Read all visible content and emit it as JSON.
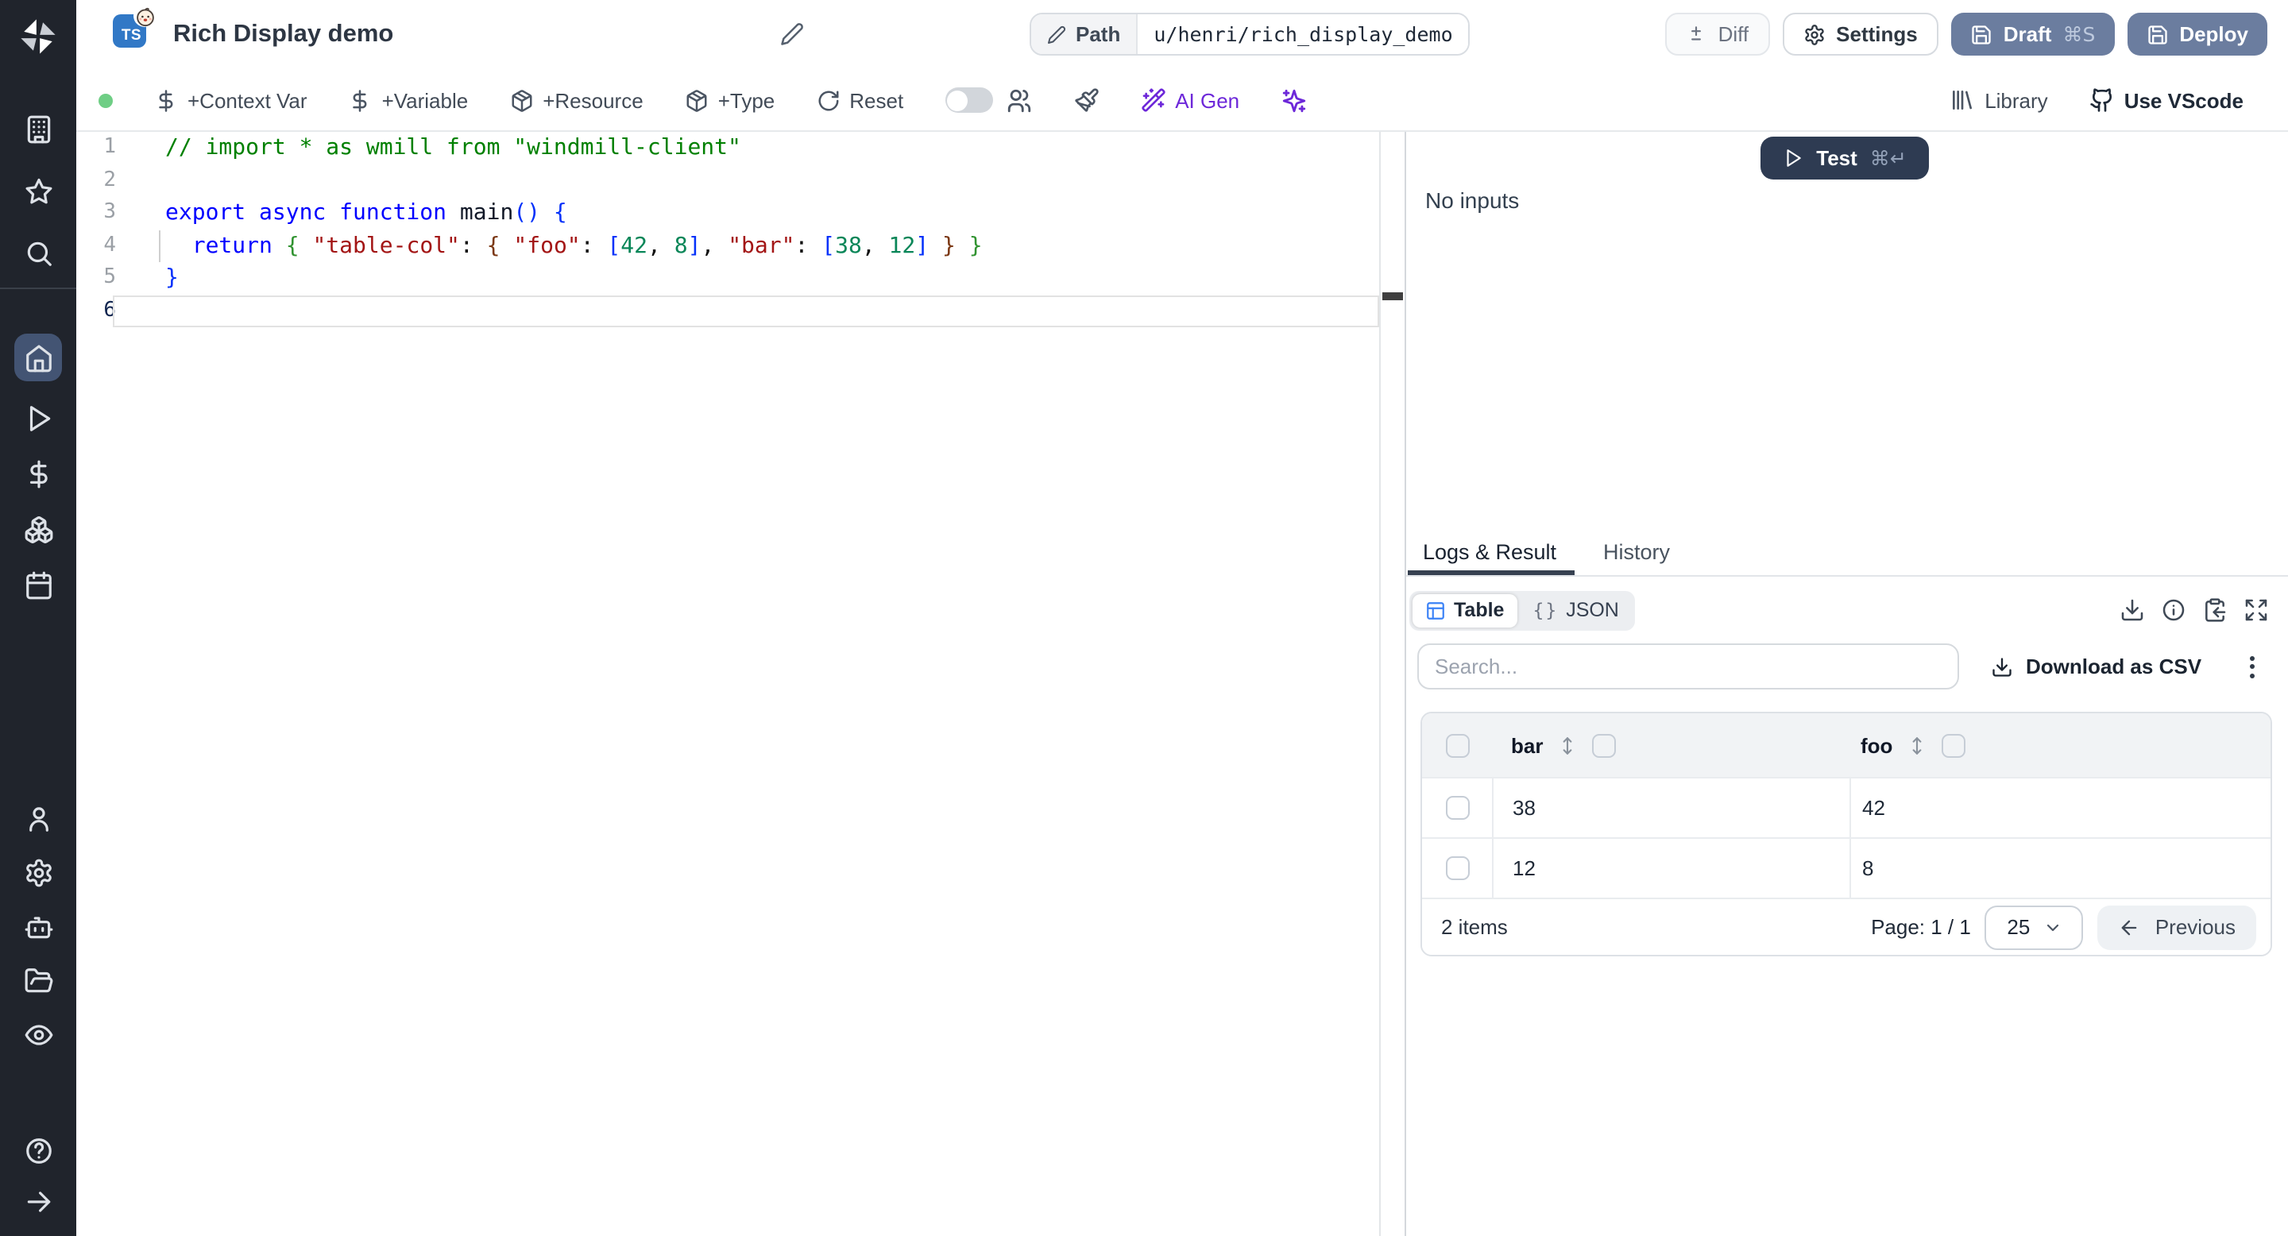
{
  "header": {
    "title": "Rich Display demo",
    "lang_badge": "TS",
    "path_label": "Path",
    "path_value": "u/henri/rich_display_demo",
    "diff_label": "Diff",
    "settings_label": "Settings",
    "draft_label": "Draft",
    "draft_shortcut": "⌘S",
    "deploy_label": "Deploy"
  },
  "toolbar": {
    "context_var_label": "+Context Var",
    "variable_label": "+Variable",
    "resource_label": "+Resource",
    "type_label": "+Type",
    "reset_label": "Reset",
    "ai_gen_label": "AI Gen",
    "library_label": "Library",
    "vscode_label": "Use VScode"
  },
  "sidebar": {
    "groups": [
      {
        "id": "sb-top",
        "items": [
          "building",
          "star",
          "search"
        ]
      },
      {
        "id": "sb-main",
        "items": [
          "home",
          "play",
          "dollar-sign",
          "boxes",
          "calendar"
        ],
        "active": "home"
      },
      {
        "id": "sb-admin",
        "items": [
          "user",
          "settings",
          "bot",
          "folder-open",
          "eye"
        ]
      },
      {
        "id": "sb-footer",
        "items": [
          "help-circle",
          "arrow-right"
        ]
      }
    ]
  },
  "editor": {
    "active_line": 6,
    "lines": [
      {
        "num": "1",
        "tokens": [
          [
            "// import * as wmill from \"windmill-client\"",
            "cmt"
          ]
        ]
      },
      {
        "num": "2",
        "tokens": []
      },
      {
        "num": "3",
        "tokens": [
          [
            "export async function ",
            "kw"
          ],
          [
            "main",
            "fn"
          ],
          [
            "()",
            "b1"
          ],
          [
            " ",
            "pln"
          ],
          [
            "{",
            "b1"
          ]
        ]
      },
      {
        "num": "4",
        "tokens": [
          [
            "  return ",
            "kw"
          ],
          [
            "{",
            "b2"
          ],
          [
            " ",
            "pln"
          ],
          [
            "\"table-col\"",
            "str"
          ],
          [
            ": ",
            "pln"
          ],
          [
            "{",
            "b3"
          ],
          [
            " ",
            "pln"
          ],
          [
            "\"foo\"",
            "str"
          ],
          [
            ": ",
            "pln"
          ],
          [
            "[",
            "b1"
          ],
          [
            "42",
            "num"
          ],
          [
            ", ",
            "pln"
          ],
          [
            "8",
            "num"
          ],
          [
            "]",
            "b1"
          ],
          [
            ", ",
            "pln"
          ],
          [
            "\"bar\"",
            "str"
          ],
          [
            ": ",
            "pln"
          ],
          [
            "[",
            "b1"
          ],
          [
            "38",
            "num"
          ],
          [
            ", ",
            "pln"
          ],
          [
            "12",
            "num"
          ],
          [
            "]",
            "b1"
          ],
          [
            " ",
            "pln"
          ],
          [
            "}",
            "b3"
          ],
          [
            " ",
            "pln"
          ],
          [
            "}",
            "b2"
          ]
        ]
      },
      {
        "num": "5",
        "tokens": [
          [
            "}",
            "b1"
          ]
        ]
      },
      {
        "num": "6",
        "tokens": []
      }
    ]
  },
  "run_panel": {
    "test_label": "Test",
    "test_shortcut": "⌘↵",
    "no_inputs": "No inputs",
    "tabs": {
      "logs": "Logs & Result",
      "history": "History"
    },
    "views": {
      "table": "Table",
      "json": "JSON",
      "braces_glyph": "{}"
    },
    "toolbar_icons": [
      "download",
      "info",
      "clipboard-copy",
      "expand"
    ],
    "search_placeholder": "Search...",
    "download_csv_label": "Download as CSV"
  },
  "result_table": {
    "columns": [
      "bar",
      "foo"
    ],
    "rows": [
      [
        "38",
        "42"
      ],
      [
        "12",
        "8"
      ]
    ],
    "items_count": "2 items",
    "page_info": "Page: 1 / 1",
    "page_size": "25",
    "previous_label": "Previous"
  },
  "colors": {
    "sidebar_bg": "#20242c",
    "sidebar_active": "#435473",
    "slate_button": "#6b7d9f",
    "test_button": "#2e3b52",
    "ai_accent": "#6d28d9",
    "ts_blue": "#3178c6",
    "table_icon_blue": "#3b82f6",
    "status_green": "#6fce85",
    "tab_underline": "#374151"
  }
}
